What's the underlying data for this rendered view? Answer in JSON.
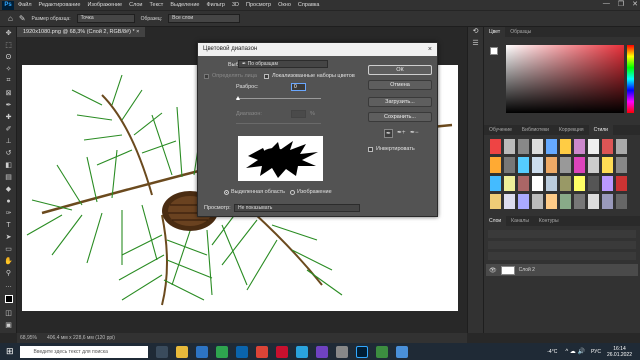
{
  "menubar": {
    "logo": "Ps",
    "items": [
      "Файл",
      "Редактирование",
      "Изображение",
      "Слои",
      "Текст",
      "Выделение",
      "Фильтр",
      "3D",
      "Просмотр",
      "Окно",
      "Справка"
    ],
    "controls": [
      "—",
      "❐",
      "✕"
    ]
  },
  "optbar": {
    "sample_size_label": "Размер образца:",
    "sample_size_value": "Точка",
    "sample_label": "Образец:",
    "sample_value": "Все слои"
  },
  "document": {
    "tab_title": "1920x1080.png @ 68,3% (Слой 2, RGB/8#) *",
    "close": "×"
  },
  "status": {
    "zoom": "68,95%",
    "size": "406,4 мм x 228,6 мм (120 ppi)"
  },
  "dialog": {
    "title": "Цветовой диапазон",
    "select_label": "Выбрать:",
    "select_value": "По образцам",
    "detect_faces": "Определять лица",
    "localized": "Локализованные наборы цветов",
    "fuzziness_label": "Разброс:",
    "fuzziness_value": "0",
    "range_label": "Диапазон:",
    "range_unit": "%",
    "radio_selection": "Выделенная область",
    "radio_image": "Изображение",
    "preview_label": "Просмотр:",
    "preview_value": "Не показывать",
    "buttons": {
      "ok": "ОК",
      "cancel": "Отмена",
      "load": "Загрузить...",
      "save": "Сохранить..."
    },
    "invert": "Инвертировать"
  },
  "panels": {
    "color_tabs": [
      "Цвет",
      "Образцы"
    ],
    "lib_tabs": [
      "Обучение",
      "Библиотеки",
      "Коррекция",
      "Стили"
    ],
    "layers_tabs": [
      "Слои",
      "Каналы",
      "Контуры"
    ],
    "layer_name": "Слой 2"
  },
  "taskbar": {
    "search_placeholder": "Введите здесь текст для поиска",
    "weather": "-4°C",
    "lang": "РУС",
    "time": "16:14",
    "date": "26.01.2022"
  }
}
